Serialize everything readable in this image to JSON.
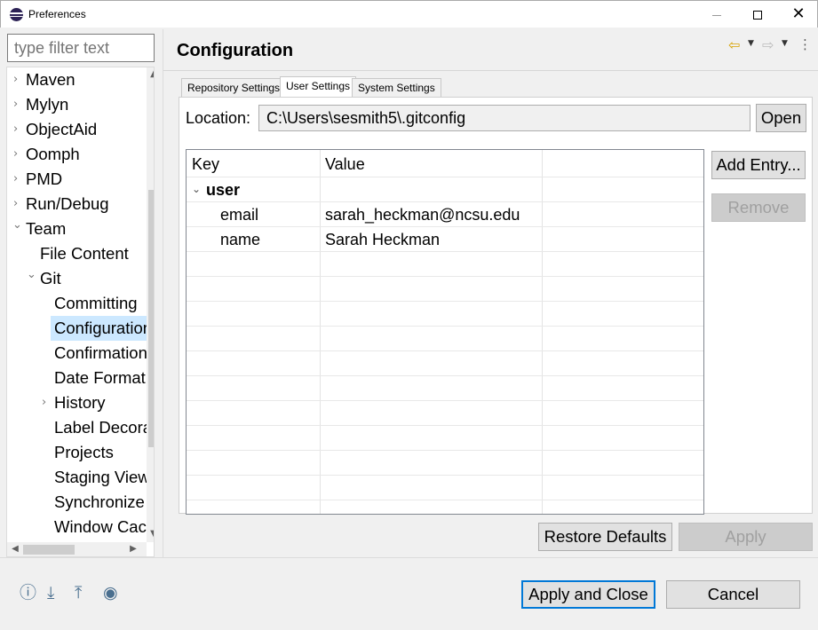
{
  "window": {
    "title": "Preferences",
    "minimize_icon": "minimize-icon",
    "maximize_icon": "maximize-icon",
    "close_icon": "close-icon"
  },
  "filter": {
    "placeholder": "type filter text"
  },
  "tree": {
    "items": [
      {
        "label": "Maven",
        "expander": "›"
      },
      {
        "label": "Mylyn",
        "expander": "›"
      },
      {
        "label": "ObjectAid",
        "expander": "›"
      },
      {
        "label": "Oomph",
        "expander": "›"
      },
      {
        "label": "PMD",
        "expander": "›"
      },
      {
        "label": "Run/Debug",
        "expander": "›"
      },
      {
        "label": "Team",
        "expander": "⌄"
      },
      {
        "label": "File Content",
        "expander": ""
      },
      {
        "label": "Git",
        "expander": "⌄"
      },
      {
        "label": "Committing",
        "expander": ""
      },
      {
        "label": "Configuration",
        "expander": "",
        "selected": true
      },
      {
        "label": "Confirmations",
        "expander": ""
      },
      {
        "label": "Date Format",
        "expander": ""
      },
      {
        "label": "History",
        "expander": "›"
      },
      {
        "label": "Label Decorations",
        "expander": ""
      },
      {
        "label": "Projects",
        "expander": ""
      },
      {
        "label": "Staging View",
        "expander": ""
      },
      {
        "label": "Synchronize",
        "expander": ""
      },
      {
        "label": "Window Cache",
        "expander": ""
      }
    ]
  },
  "panel": {
    "title": "Configuration",
    "tabs": [
      {
        "label": "Repository Settings"
      },
      {
        "label": "User Settings",
        "active": true
      },
      {
        "label": "System Settings"
      }
    ],
    "location_label": "Location:",
    "location_value": "C:\\Users\\sesmith5\\.gitconfig",
    "open_label": "Open",
    "table": {
      "headers": [
        "Key",
        "Value"
      ],
      "group": "user",
      "rows": [
        {
          "key": "email",
          "value": "sarah_heckman@ncsu.edu"
        },
        {
          "key": "name",
          "value": "Sarah Heckman"
        }
      ]
    },
    "add_entry_label": "Add Entry...",
    "remove_label": "Remove",
    "restore_defaults_label": "Restore Defaults",
    "apply_label": "Apply"
  },
  "footer": {
    "apply_close_label": "Apply and Close",
    "cancel_label": "Cancel",
    "icons": [
      "help-icon",
      "import-icon",
      "export-icon",
      "record-icon"
    ]
  }
}
